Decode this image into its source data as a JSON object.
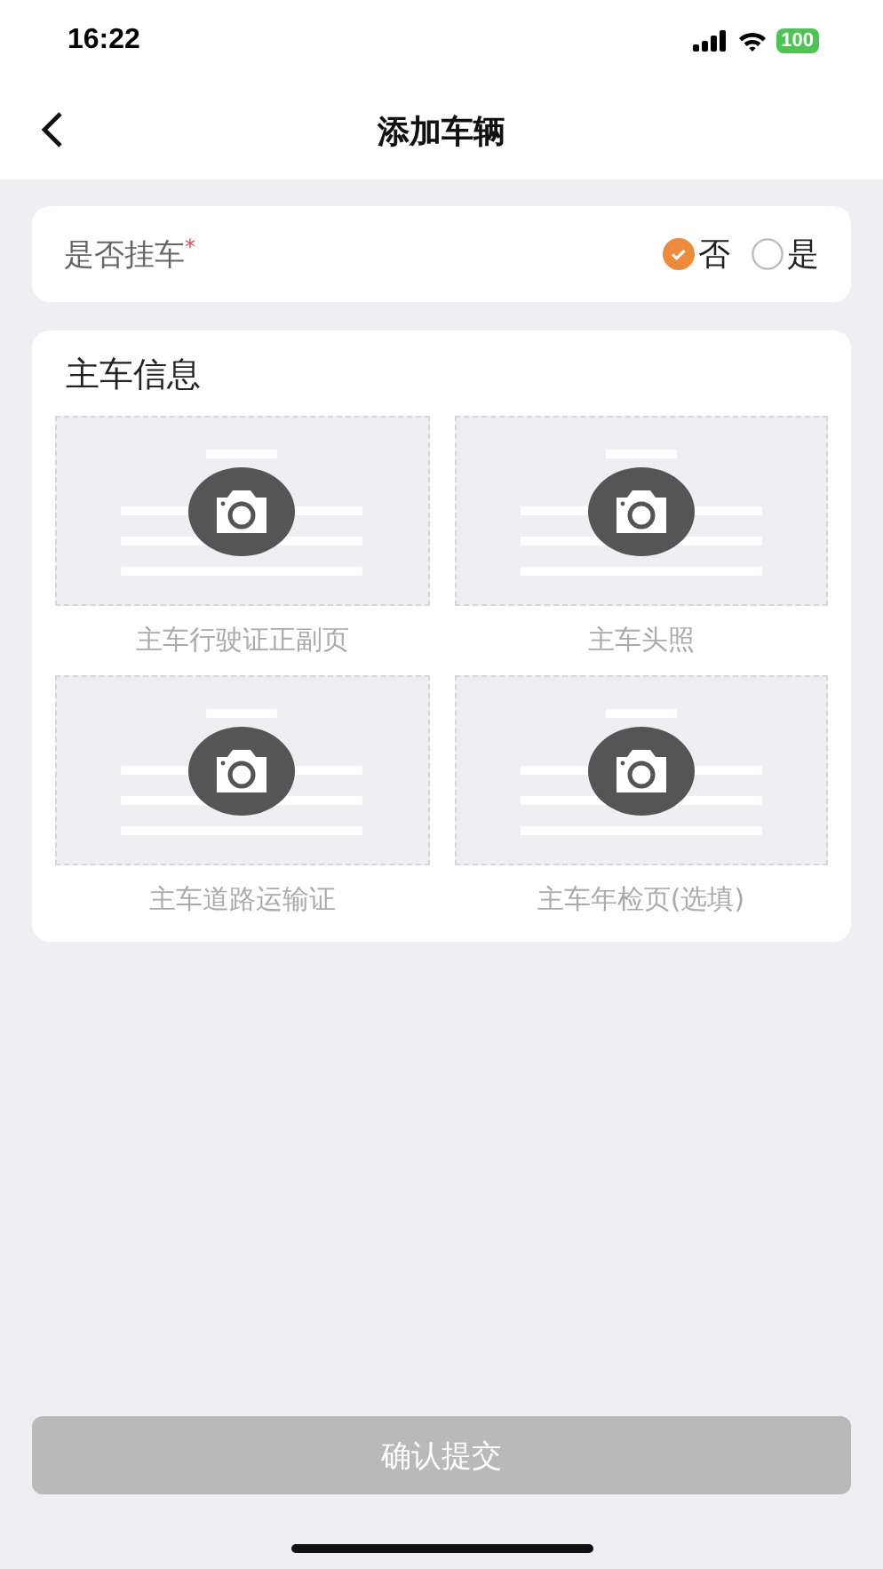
{
  "status_bar": {
    "time": "16:22",
    "battery": "100"
  },
  "nav": {
    "title": "添加车辆"
  },
  "trailer": {
    "label": "是否挂车",
    "required_mark": "*",
    "options": [
      {
        "label": "否",
        "selected": true
      },
      {
        "label": "是",
        "selected": false
      }
    ]
  },
  "section": {
    "title": "主车信息",
    "uploads": [
      {
        "label": "主车行驶证正副页"
      },
      {
        "label": "主车头照"
      },
      {
        "label": "主车道路运输证"
      },
      {
        "label": "主车年检页(选填)"
      }
    ]
  },
  "submit": {
    "label": "确认提交",
    "disabled": true
  }
}
